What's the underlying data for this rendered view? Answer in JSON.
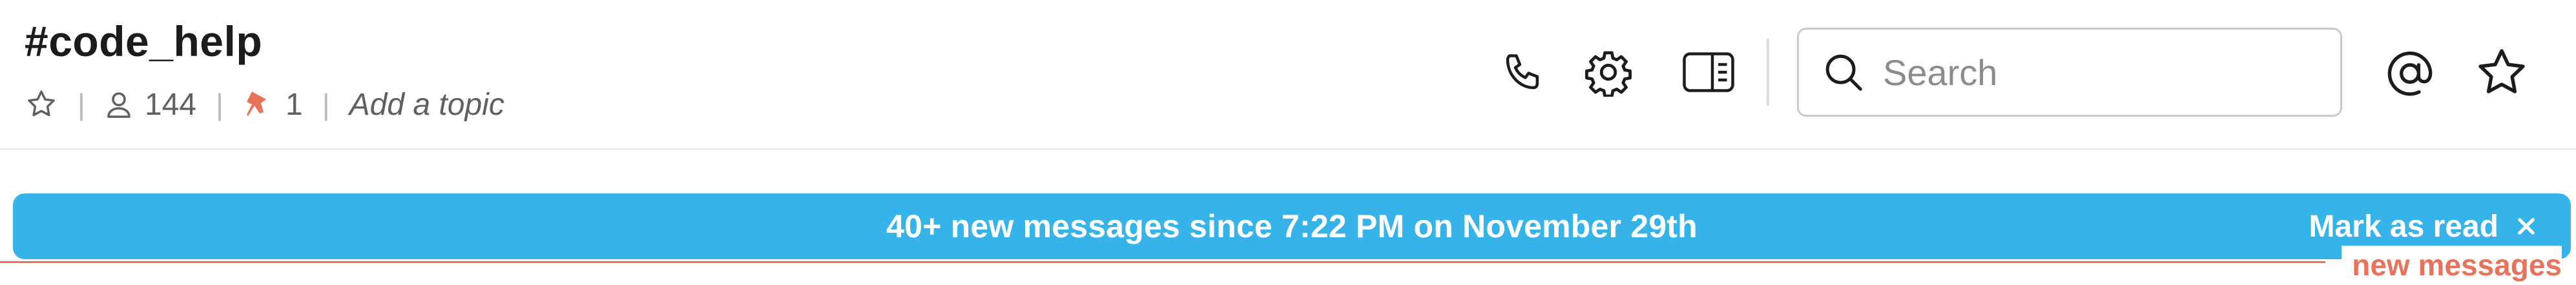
{
  "header": {
    "channel_name": "#code_help",
    "member_count": "144",
    "pinned_count": "1",
    "topic_placeholder": "Add a topic",
    "separator": "|"
  },
  "search": {
    "placeholder": "Search"
  },
  "icons": {
    "star": "star-icon",
    "member": "person-icon",
    "pin": "pin-icon",
    "call": "phone-icon",
    "settings": "gear-icon",
    "details": "sidebar-panel-icon",
    "search": "search-icon",
    "mentions": "at-sign-icon",
    "starred": "star-icon",
    "close": "close-icon"
  },
  "banner": {
    "text": "40+ new messages since 7:22 PM on November 29th",
    "mark_as_read": "Mark as read",
    "color": "#36b3e9"
  },
  "divider": {
    "label": "new messages",
    "color": "#e8735a"
  }
}
